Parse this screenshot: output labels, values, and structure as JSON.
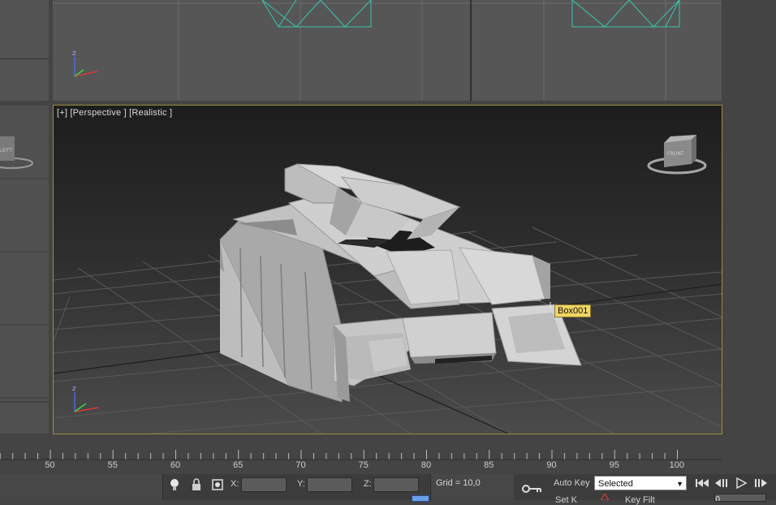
{
  "viewport_main": {
    "label": "[+] [Perspective ] [Realistic ]",
    "object_name": "Box001",
    "viewcube_face": "FRONT"
  },
  "viewport_left": {
    "viewcube_face": "LEFT"
  },
  "gizmo_axis_label": "z",
  "timeline": {
    "ticks": [
      "50",
      "55",
      "60",
      "65",
      "70",
      "75",
      "80",
      "85",
      "90",
      "95",
      "100"
    ]
  },
  "statusbar": {
    "x_label": "X:",
    "y_label": "Y:",
    "z_label": "Z:",
    "x_value": "",
    "y_value": "",
    "z_value": "",
    "grid_text": "Grid = 10,0",
    "auto_key_label": "Auto Key",
    "set_key_label": "Set K",
    "key_filters_label": "Key Filt",
    "selection_value": "Selected",
    "frame_value": "0"
  },
  "colors": {
    "active_viewport_border": "#a08c3c",
    "tooltip_bg": "#f2d562",
    "grid_line": "#5a5a5a",
    "axis_x": "#d83a3a",
    "axis_y": "#3ad83a",
    "axis_z": "#4a6ae0",
    "wireframe": "#39c7b0"
  },
  "icons": [
    "lightbulb-icon",
    "lock-icon",
    "transform-icon",
    "key-icon",
    "go-to-start-icon",
    "prev-frame-icon",
    "play-icon",
    "next-frame-icon",
    "filter-icon"
  ]
}
